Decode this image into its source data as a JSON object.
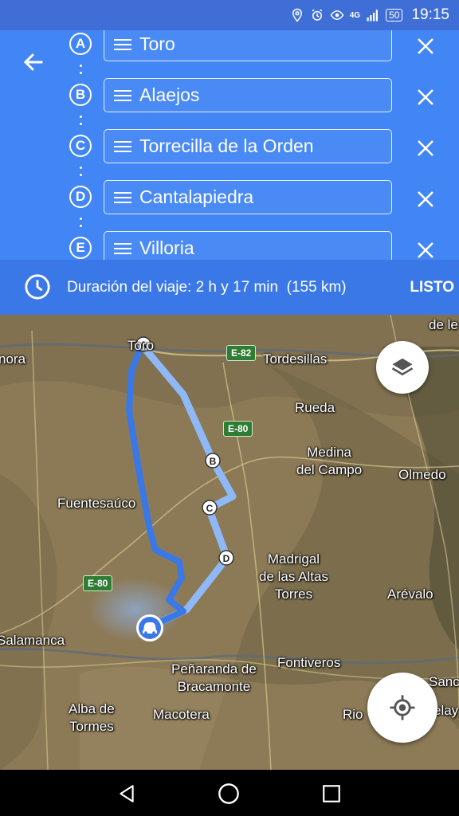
{
  "status_bar": {
    "icons": [
      "location-icon",
      "alarm-icon",
      "eye-icon",
      "signal-icon"
    ],
    "network": "4G",
    "battery": "50",
    "time": "19:15"
  },
  "header": {
    "back_icon": "arrow-back-icon",
    "stops": [
      {
        "letter": "A",
        "name": "Toro"
      },
      {
        "letter": "B",
        "name": "Alaejos"
      },
      {
        "letter": "C",
        "name": "Torrecilla de la Orden"
      },
      {
        "letter": "D",
        "name": "Cantalapiedra"
      },
      {
        "letter": "E",
        "name": "Villoria"
      }
    ]
  },
  "trip": {
    "icon": "clock-icon",
    "summary": "Duración del viaje: 2 h y 17 min  (155 km)",
    "done_label": "LISTO"
  },
  "map": {
    "place_labels": {
      "toro": "Toro",
      "tordesillas": "Tordesillas",
      "nora": "nora",
      "rueda": "Rueda",
      "medina": "Medina\ndel Campo",
      "olmedo": "Olmedo",
      "fuentesauco": "Fuentesaúco",
      "madrigal": "Madrigal\nde las Altas\nTorres",
      "arevalo": "Arévalo",
      "salamanca": "Salamanca",
      "penaranda": "Peñaranda de\nBracamonte",
      "fontiveros": "Fontiveros",
      "alba": "Alba de\nTormes",
      "macotera": "Macotera",
      "rio": "Rio",
      "san": "Sanc",
      "delay": "elay",
      "dele": "de le"
    },
    "road_shields": {
      "e82": "E-82",
      "e80_top": "E-80",
      "e80_left": "E-80"
    },
    "route_markers": [
      "A",
      "B",
      "C",
      "D"
    ],
    "route_color": "#4285f4",
    "alt_route_color": "#8fb8f8",
    "layers_icon": "layers-icon",
    "my_location_icon": "my-location-icon",
    "car_icon": "car-icon"
  },
  "nav_bar": {
    "back": "triangle-back-icon",
    "home": "circle-home-icon",
    "recents": "square-recents-icon"
  }
}
